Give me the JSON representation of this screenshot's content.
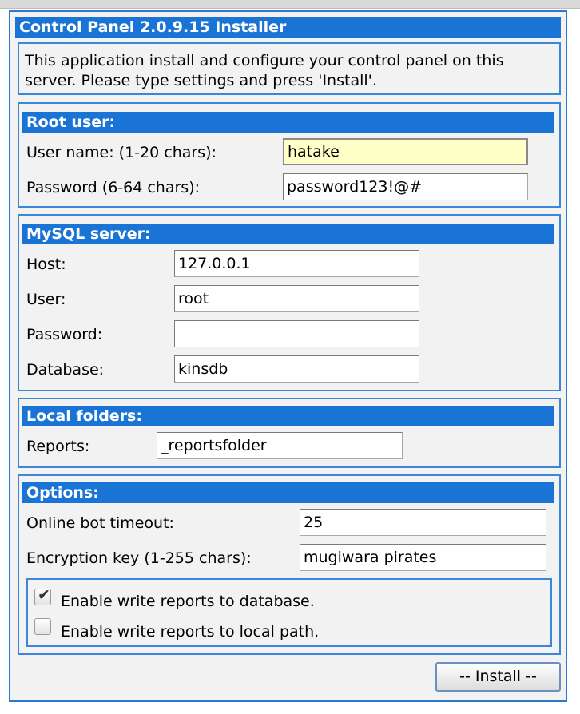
{
  "title": "Control Panel 2.0.9.15 Installer",
  "description": "This application install and configure your control panel on this server. Please type settings and press 'Install'.",
  "root_user": {
    "heading": "Root user:",
    "username_label": "User name: (1-20 chars):",
    "username_value": "hatake",
    "password_label": "Password (6-64 chars):",
    "password_value": "password123!@#"
  },
  "mysql": {
    "heading": "MySQL server:",
    "host_label": "Host:",
    "host_value": "127.0.0.1",
    "user_label": "User:",
    "user_value": "root",
    "password_label": "Password:",
    "password_value": "",
    "database_label": "Database:",
    "database_value": "kinsdb"
  },
  "local_folders": {
    "heading": "Local folders:",
    "reports_label": "Reports:",
    "reports_value": "_reportsfolder"
  },
  "options": {
    "heading": "Options:",
    "timeout_label": "Online bot timeout:",
    "timeout_value": "25",
    "key_label": "Encryption key (1-255 chars):",
    "key_value": "mugiwara pirates",
    "write_db_label": "Enable write reports to database.",
    "write_db_checked": true,
    "write_local_label": "Enable write reports to local path.",
    "write_local_checked": false
  },
  "install_label": "-- Install --",
  "colors": {
    "header_bar": "#1a74d6",
    "border": "#3a86d8",
    "panel_bg": "#f2f2f2",
    "focus_field": "#ffffc8"
  }
}
